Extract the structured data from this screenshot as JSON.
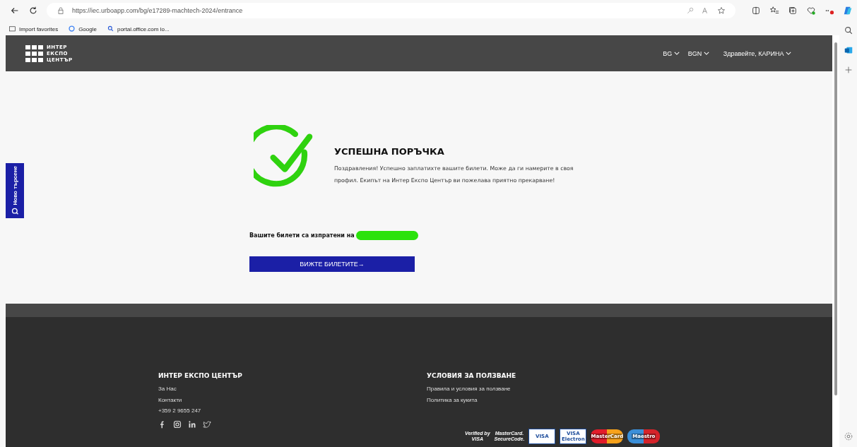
{
  "browser": {
    "url": "https://iec.urboapp.com/bg/e17289-machtech-2024/entrance",
    "favorites": [
      "Import favorites",
      "Google",
      "portal.office.com lo..."
    ]
  },
  "header": {
    "logo": [
      "ИНТЕР",
      "ЕКСПО",
      "ЦЕНТЪР"
    ],
    "menus": [
      "BG",
      "BGN",
      "Здравейте, КАРИНА"
    ]
  },
  "side_tab": {
    "label": "Ново търсене"
  },
  "success": {
    "title": "УСПЕШНА ПОРЪЧКА",
    "message": "Поздравления! Успешно заплатихте вашите билети. Може да ги намерите в своя профил. Екипът на Интер Експо Център ви пожелава приятно прекарване!",
    "sent_to": "Вашите билети са изпратени на",
    "button": "ВИЖТЕ БИЛЕТИТЕ→"
  },
  "footer": {
    "columns": [
      {
        "heading": "ИНТЕР ЕКСПО ЦЕНТЪР",
        "links": [
          "За Нас",
          "Контакти",
          "+359 2 9655 247"
        ],
        "social": true
      },
      {
        "heading": "УСЛОВИЯ ЗА ПОЛЗВАНЕ",
        "links": [
          "Правила и условия за ползване",
          "Политика за кукита"
        ],
        "social": false
      }
    ],
    "payments": [
      {
        "kind": "wordmark",
        "lines": [
          "Verified by",
          "VISA"
        ]
      },
      {
        "kind": "wordmark",
        "lines": [
          "MasterCard.",
          "SecureCode."
        ]
      },
      {
        "kind": "card",
        "lines": [
          "VISA"
        ]
      },
      {
        "kind": "card",
        "lines": [
          "VISA",
          "Electron"
        ]
      },
      {
        "kind": "circles",
        "lines": [
          "MasterCard"
        ]
      },
      {
        "kind": "circles",
        "lines": [
          "Maestro"
        ]
      }
    ]
  }
}
